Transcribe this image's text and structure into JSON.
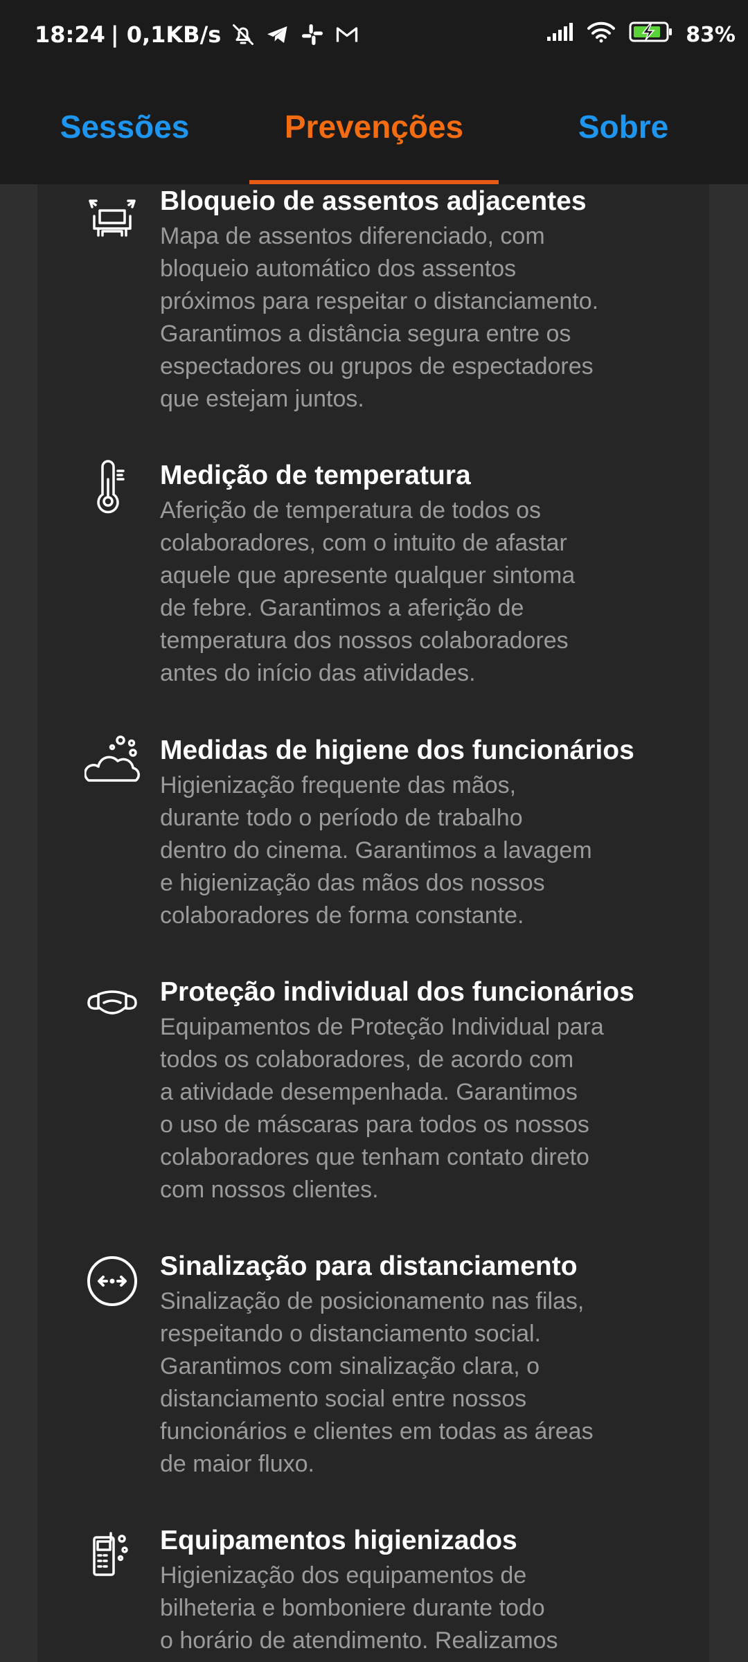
{
  "status_bar": {
    "time": "18:24",
    "speed": "| 0,1KB/s",
    "battery": "83%",
    "icons": [
      "bell-off-icon",
      "telegram-icon",
      "slack-icon",
      "gmail-icon",
      "signal-icon",
      "wifi-icon",
      "battery-charging-icon"
    ]
  },
  "tabs": [
    {
      "label": "Sessões",
      "active": false
    },
    {
      "label": "Prevenções",
      "active": true
    },
    {
      "label": "Sobre",
      "active": false
    }
  ],
  "colors": {
    "tab_inactive": "#1e96f0",
    "tab_active": "#f36c12",
    "indicator": "#e65a16",
    "background": "#262626",
    "title": "#ffffff",
    "description": "#9b9b9b"
  },
  "items": [
    {
      "icon": "seat-block-icon",
      "title": "Bloqueio de assentos adjacentes",
      "lines": [
        "Mapa de assentos diferenciado, com",
        "bloqueio automático dos assentos",
        "próximos para respeitar o distanciamento.",
        "Garantimos a distância segura entre os",
        "espectadores ou grupos de espectadores",
        "que estejam juntos."
      ]
    },
    {
      "icon": "thermometer-icon",
      "title": "Medição de temperatura",
      "lines": [
        "Aferição de temperatura de todos os",
        "colaboradores, com o intuito de afastar",
        "aquele que apresente qualquer sintoma",
        "de febre. Garantimos a aferição de",
        "temperatura dos nossos colaboradores",
        "antes do início das atividades."
      ]
    },
    {
      "icon": "hygiene-foam-icon",
      "title": "Medidas de higiene dos funcionários",
      "lines": [
        "Higienização frequente das mãos,",
        "durante todo o período de trabalho",
        "dentro do cinema. Garantimos a lavagem",
        "e higienização das mãos dos nossos",
        "colaboradores de forma constante."
      ]
    },
    {
      "icon": "face-mask-icon",
      "title": "Proteção individual dos funcionários",
      "lines": [
        "Equipamentos de Proteção Individual para",
        "todos os colaboradores, de acordo com",
        "a atividade desempenhada. Garantimos",
        "o uso de máscaras para todos os nossos",
        "colaboradores que tenham contato direto",
        "com nossos clientes."
      ]
    },
    {
      "icon": "distance-arrows-icon",
      "title": "Sinalização para distanciamento",
      "lines": [
        "Sinalização de posicionamento nas filas,",
        "respeitando o distanciamento social.",
        "Garantimos com sinalização clara, o",
        "distanciamento social entre nossos",
        "funcionários e clientes em todas as áreas",
        "de maior fluxo."
      ]
    },
    {
      "icon": "sanitized-equipment-icon",
      "title": "Equipamentos higienizados",
      "lines": [
        "Higienização dos equipamentos de",
        "bilheteria e bomboniere durante todo",
        "o horário de atendimento. Realizamos"
      ]
    }
  ]
}
